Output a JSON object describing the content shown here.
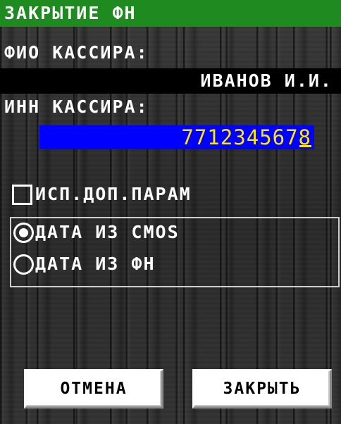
{
  "header": {
    "title": "ЗАКРЫТИЕ ФН"
  },
  "cashier": {
    "name_label": "ФИО КАССИРА:",
    "name_value": "ИВАНОВ И.И.",
    "inn_label": "ИНН КАССИРА:",
    "inn_value": "7712345678"
  },
  "options": {
    "extra_params_label": "ИСП.ДОП.ПАРАМ",
    "extra_params_checked": false,
    "date_source": {
      "options": [
        {
          "label": "ДАТА ИЗ CMOS",
          "selected": true
        },
        {
          "label": "ДАТА ИЗ ФН",
          "selected": false
        }
      ]
    }
  },
  "buttons": {
    "cancel": "ОТМЕНА",
    "close": "ЗАКРЫТЬ"
  },
  "colors": {
    "title_bar": "#1f8a1f",
    "input_bg": "#0000ff",
    "input_text": "#ffe600",
    "name_bar": "#000000"
  }
}
